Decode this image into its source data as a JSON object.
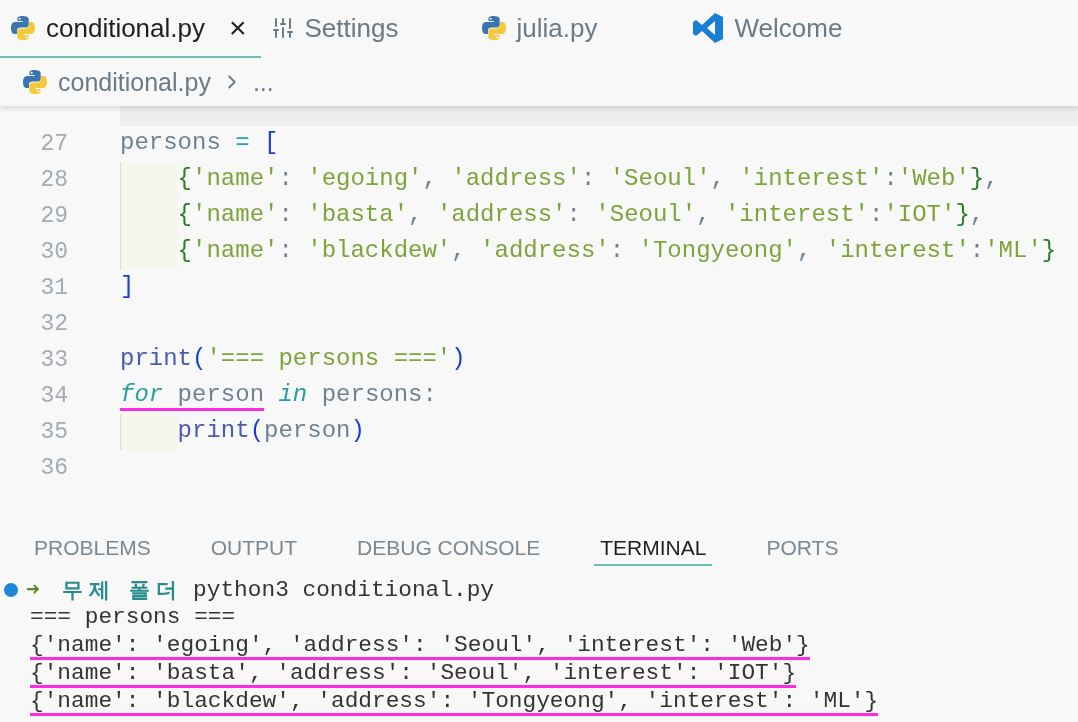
{
  "tabs": [
    {
      "label": "conditional.py",
      "kind": "python",
      "selected": true,
      "close": "×"
    },
    {
      "label": "Settings",
      "kind": "settings",
      "selected": false
    },
    {
      "label": "julia.py",
      "kind": "python",
      "selected": false
    },
    {
      "label": "Welcome",
      "kind": "vscode",
      "selected": false
    }
  ],
  "breadcrumb": {
    "file": "conditional.py",
    "rest": "..."
  },
  "editor": {
    "lines": [
      {
        "number": "27",
        "tokens": [
          {
            "t": "persons",
            "kind": "var"
          },
          {
            "t": " = ",
            "kind": "op"
          },
          {
            "t": "[",
            "kind": "bracket"
          }
        ],
        "children": [
          {
            "number": "28",
            "tokens": [
              {
                "t": "{",
                "kind": "brace"
              },
              {
                "t": "'name'",
                "kind": "str"
              },
              {
                "t": ": ",
                "kind": "punct"
              },
              {
                "t": "'egoing'",
                "kind": "str"
              },
              {
                "t": ", ",
                "kind": "punct"
              },
              {
                "t": "'address'",
                "kind": "str"
              },
              {
                "t": ": ",
                "kind": "punct"
              },
              {
                "t": "'Seoul'",
                "kind": "str"
              },
              {
                "t": ", ",
                "kind": "punct"
              },
              {
                "t": "'interest'",
                "kind": "str"
              },
              {
                "t": ":",
                "kind": "punct"
              },
              {
                "t": "'Web'",
                "kind": "str"
              },
              {
                "t": "}",
                "kind": "brace"
              },
              {
                "t": ",",
                "kind": "punct"
              }
            ]
          },
          {
            "number": "29",
            "tokens": [
              {
                "t": "{",
                "kind": "brace"
              },
              {
                "t": "'name'",
                "kind": "str"
              },
              {
                "t": ": ",
                "kind": "punct"
              },
              {
                "t": "'basta'",
                "kind": "str"
              },
              {
                "t": ", ",
                "kind": "punct"
              },
              {
                "t": "'address'",
                "kind": "str"
              },
              {
                "t": ": ",
                "kind": "punct"
              },
              {
                "t": "'Seoul'",
                "kind": "str"
              },
              {
                "t": ", ",
                "kind": "punct"
              },
              {
                "t": "'interest'",
                "kind": "str"
              },
              {
                "t": ":",
                "kind": "punct"
              },
              {
                "t": "'IOT'",
                "kind": "str"
              },
              {
                "t": "}",
                "kind": "brace"
              },
              {
                "t": ",",
                "kind": "punct"
              }
            ]
          },
          {
            "number": "30",
            "tokens": [
              {
                "t": "{",
                "kind": "brace"
              },
              {
                "t": "'name'",
                "kind": "str"
              },
              {
                "t": ": ",
                "kind": "punct"
              },
              {
                "t": "'blackdew'",
                "kind": "str"
              },
              {
                "t": ", ",
                "kind": "punct"
              },
              {
                "t": "'address'",
                "kind": "str"
              },
              {
                "t": ": ",
                "kind": "punct"
              },
              {
                "t": "'Tongyeong'",
                "kind": "str"
              },
              {
                "t": ", ",
                "kind": "punct"
              },
              {
                "t": "'interest'",
                "kind": "str"
              },
              {
                "t": ":",
                "kind": "punct"
              },
              {
                "t": "'ML'",
                "kind": "str"
              },
              {
                "t": "}",
                "kind": "brace"
              }
            ]
          }
        ]
      },
      {
        "number": "31",
        "tokens": [
          {
            "t": "]",
            "kind": "bracket"
          }
        ]
      },
      {
        "number": "32"
      },
      {
        "number": "33",
        "tokens": [
          {
            "t": "print",
            "kind": "func"
          },
          {
            "t": "(",
            "kind": "bracket"
          },
          {
            "t": "'=== persons ==='",
            "kind": "str"
          },
          {
            "t": ")",
            "kind": "bracket"
          }
        ]
      },
      {
        "number": "34",
        "tokens": [
          {
            "t": "for",
            "kind": "kw",
            "underlined": true
          },
          {
            "t": " person",
            "kind": "var",
            "underlined": true
          },
          {
            "t": " in",
            "kind": "kw"
          },
          {
            "t": " persons:",
            "kind": "var"
          }
        ],
        "children": [
          {
            "number": "35",
            "tokens": [
              {
                "t": "print",
                "kind": "func"
              },
              {
                "t": "(",
                "kind": "bracket"
              },
              {
                "t": "person",
                "kind": "var"
              },
              {
                "t": ")",
                "kind": "bracket"
              }
            ]
          }
        ]
      },
      {
        "number": "36"
      }
    ]
  },
  "panel": {
    "tabs": [
      {
        "label": "PROBLEMS",
        "selected": false
      },
      {
        "label": "OUTPUT",
        "selected": false
      },
      {
        "label": "DEBUG CONSOLE",
        "selected": false
      },
      {
        "label": "TERMINAL",
        "selected": true
      },
      {
        "label": "PORTS",
        "selected": false
      }
    ],
    "terminal": [
      {
        "kind": "prompt",
        "arrow": "➜",
        "folder": "무제 폴더",
        "command": "python3 conditional.py"
      },
      {
        "kind": "output",
        "text": "=== persons ===",
        "underlined": false
      },
      {
        "kind": "output",
        "text": "{'name': 'egoing', 'address': 'Seoul', 'interest': 'Web'}",
        "underlined": true
      },
      {
        "kind": "output",
        "text": "{'name': 'basta', 'address': 'Seoul', 'interest': 'IOT'}",
        "underlined": true
      },
      {
        "kind": "output",
        "text": "{'name': 'blackdew', 'address': 'Tongyeong', 'interest': 'ML'}",
        "underlined": true
      }
    ]
  }
}
